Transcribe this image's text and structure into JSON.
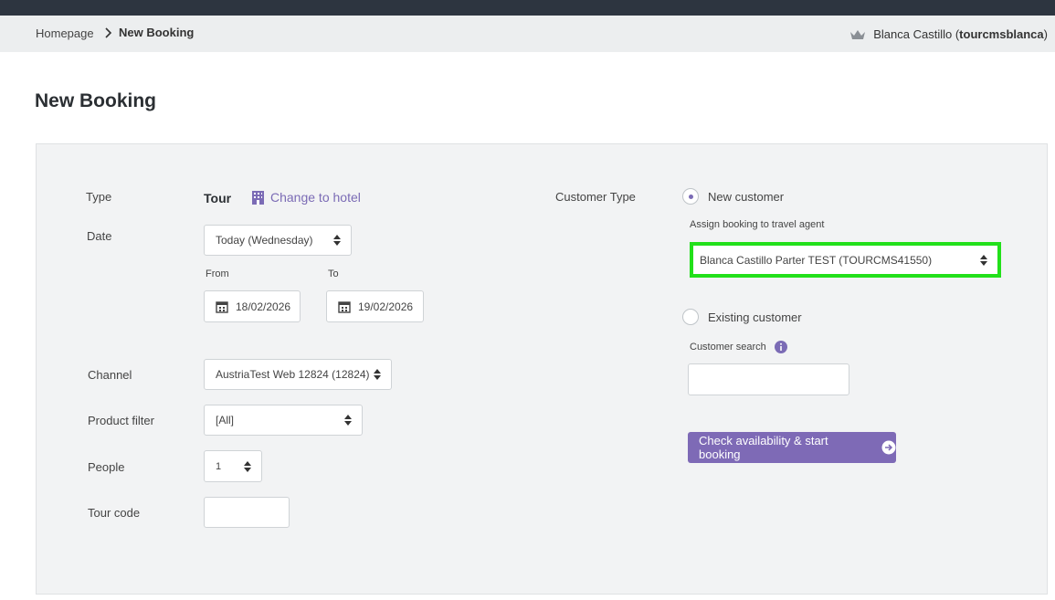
{
  "breadcrumb": {
    "home": "Homepage",
    "current": "New Booking"
  },
  "user": {
    "name_prefix": "Blanca Castillo (",
    "username": "tourcmsblanca",
    "name_suffix": ")"
  },
  "page": {
    "title": "New Booking"
  },
  "form": {
    "type_label": "Type",
    "type_value": "Tour",
    "change_link": "Change to hotel",
    "date_label": "Date",
    "date_select": "Today (Wednesday)",
    "from_label": "From",
    "to_label": "To",
    "from_value": "18/02/2026",
    "to_value": "19/02/2026",
    "channel_label": "Channel",
    "channel_value": "AustriaTest Web 12824 (12824)",
    "product_filter_label": "Product filter",
    "product_filter_value": "[All]",
    "people_label": "People",
    "people_value": "1",
    "tour_code_label": "Tour code",
    "tour_code_value": ""
  },
  "customer": {
    "type_label": "Customer Type",
    "new_customer": "New customer",
    "assign_label": "Assign booking to travel agent",
    "agent_value": "Blanca Castillo Parter TEST (TOURCMS41550)",
    "existing_customer": "Existing customer",
    "search_label": "Customer search",
    "search_value": "",
    "submit": "Check availability & start booking"
  },
  "colors": {
    "accent": "#7e6ab6",
    "highlight": "#22e01a",
    "topbar": "#2d3540"
  }
}
